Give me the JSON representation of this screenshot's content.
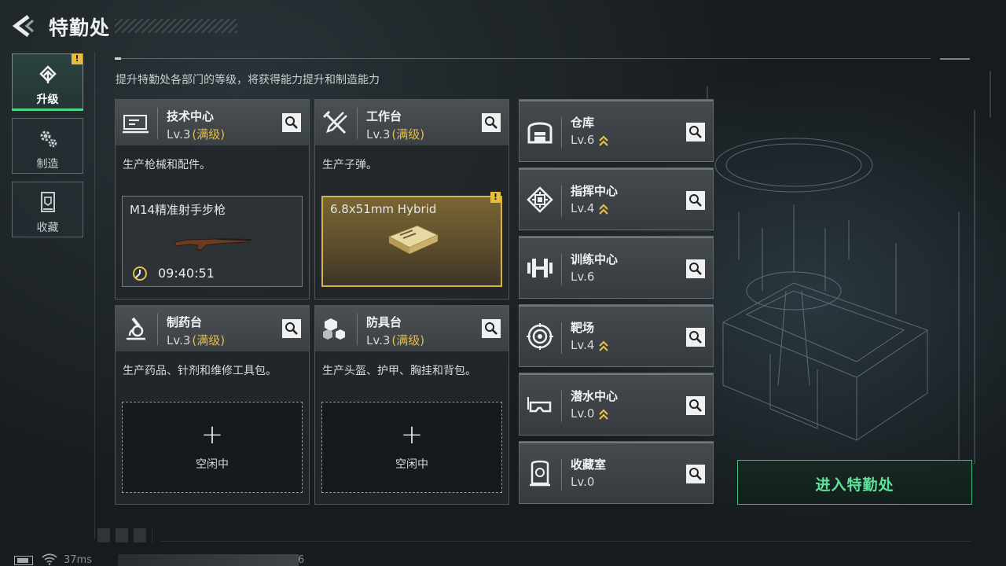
{
  "header": {
    "title": "特勤处",
    "subtitle": "提升特勤处各部门的等级，将获得能力提升和制造能力"
  },
  "nav": {
    "items": [
      {
        "label": "升级",
        "icon": "upgrade-icon",
        "active": true,
        "badge": "!"
      },
      {
        "label": "制造",
        "icon": "gear-icon",
        "active": false
      },
      {
        "label": "收藏",
        "icon": "collection-icon",
        "active": false
      }
    ]
  },
  "cards": {
    "tech": {
      "name": "技术中心",
      "level": "Lv.3",
      "max": "(满级)",
      "desc": "生产枪械和配件。",
      "slot": {
        "title": "M14精准射手步枪",
        "timer": "09:40:51"
      }
    },
    "workbench": {
      "name": "工作台",
      "level": "Lv.3",
      "max": "(满级)",
      "desc": "生产子弹。",
      "slot": {
        "title": "6.8x51mm Hybrid",
        "badge": "!"
      }
    },
    "pharmacy": {
      "name": "制药台",
      "level": "Lv.3",
      "max": "(满级)",
      "desc": "生产药品、针剂和维修工具包。",
      "slot": {
        "plus": "+",
        "label": "空闲中"
      }
    },
    "armor": {
      "name": "防具台",
      "level": "Lv.3",
      "max": "(满级)",
      "desc": "生产头盔、护甲、胸挂和背包。",
      "slot": {
        "plus": "+",
        "label": "空闲中"
      }
    }
  },
  "small_cards": [
    {
      "name": "仓库",
      "level": "Lv.6",
      "upgradable": true,
      "icon": "warehouse-icon"
    },
    {
      "name": "指挥中心",
      "level": "Lv.4",
      "upgradable": true,
      "icon": "chip-icon"
    },
    {
      "name": "训练中心",
      "level": "Lv.6",
      "upgradable": false,
      "icon": "dumbbell-icon"
    },
    {
      "name": "靶场",
      "level": "Lv.4",
      "upgradable": true,
      "icon": "target-icon"
    },
    {
      "name": "潜水中心",
      "level": "Lv.0",
      "upgradable": true,
      "icon": "diving-mask-icon"
    },
    {
      "name": "收藏室",
      "level": "Lv.0",
      "upgradable": false,
      "icon": "collection-room-icon"
    }
  ],
  "enter_button": {
    "label": "进入特勤处"
  },
  "status": {
    "ping": "37ms",
    "value": "6"
  },
  "colors": {
    "accent_green": "#4dd587",
    "gold": "#e7bd46",
    "badge": "#e6bd3c"
  }
}
